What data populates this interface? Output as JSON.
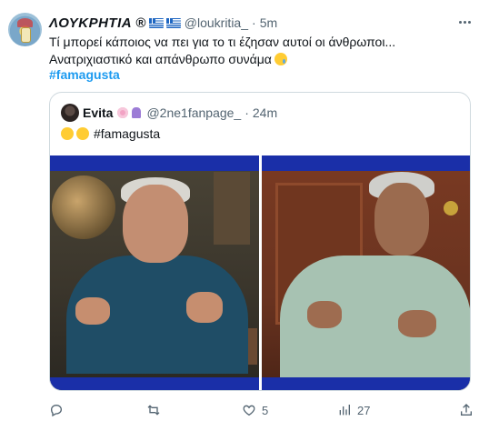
{
  "author": {
    "display_name": "ΛΟΥΚΡΗΤΙΑ ®",
    "handle": "@loukritia_",
    "separator": "·",
    "time": "5m",
    "flag_icon": "greece-flag-icon"
  },
  "tweet": {
    "line1": "Τί μπορεί κάποιος να πει για το τι έζησαν αυτοί οι άνθρωποι...",
    "line2": "Ανατριχιαστικό και απάνθρωπο συνάμα",
    "hashtag": "#famagusta"
  },
  "quote": {
    "display_name": "Evita",
    "handle": "@2ne1fanpage_",
    "separator": "·",
    "time": "24m",
    "text": "#famagusta"
  },
  "actions": {
    "reply_count": "",
    "retweet_count": "",
    "like_count": "5",
    "views_count": "27"
  },
  "colors": {
    "link": "#1d9bf0",
    "muted": "#536471",
    "border": "#cfd9de",
    "media_bar": "#1a2fa8"
  }
}
